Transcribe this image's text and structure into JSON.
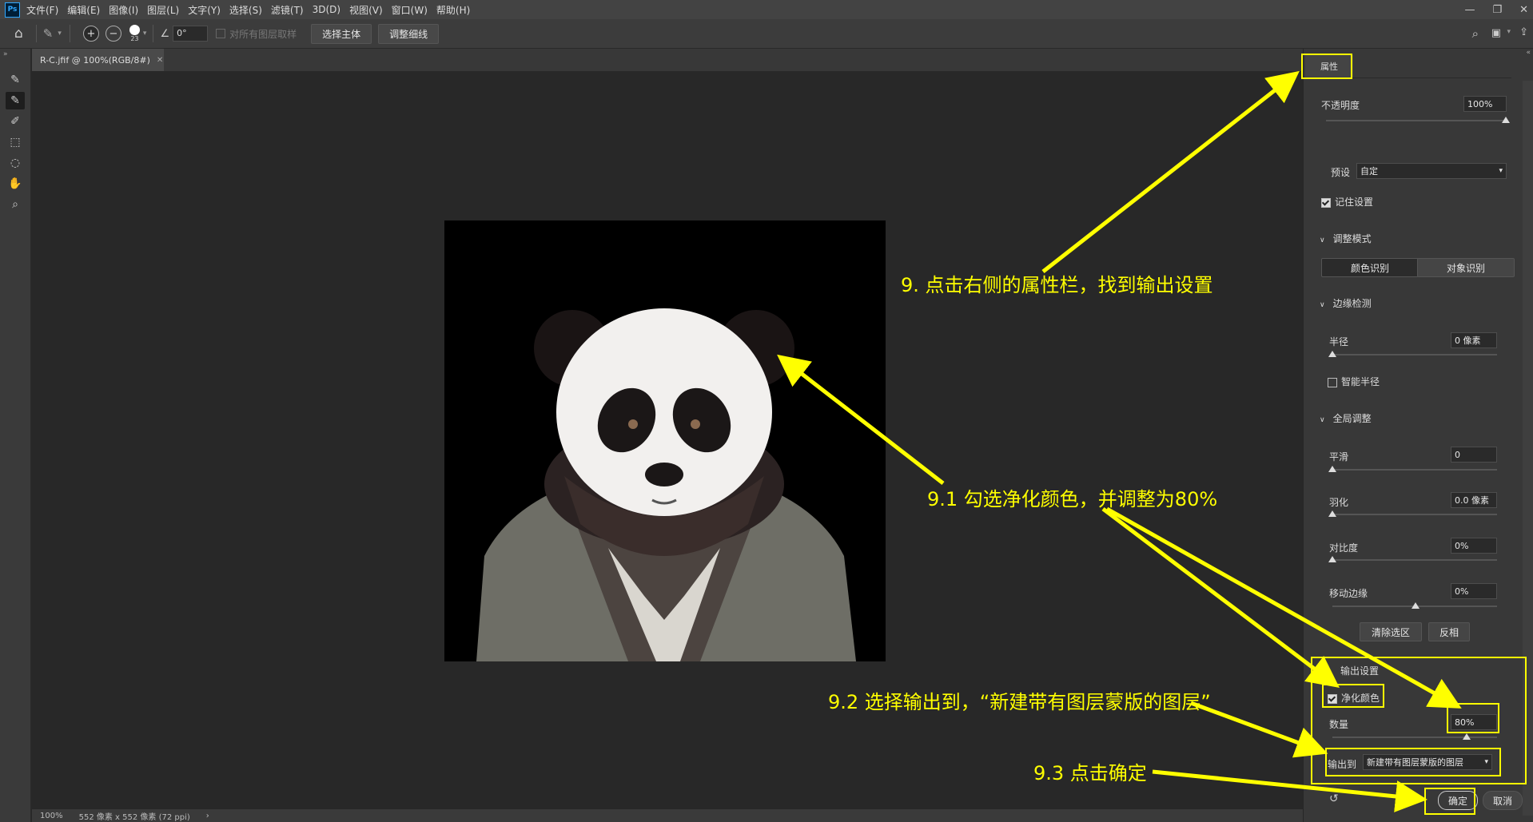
{
  "menu": {
    "app_icon": "Ps",
    "items": [
      "文件(F)",
      "编辑(E)",
      "图像(I)",
      "图层(L)",
      "文字(Y)",
      "选择(S)",
      "滤镜(T)",
      "3D(D)",
      "视图(V)",
      "窗口(W)",
      "帮助(H)"
    ]
  },
  "options": {
    "brush_size": "23",
    "angle": "0°",
    "sample_all_layers": "对所有图层取样",
    "select_subject": "选择主体",
    "refine_hair": "调整细线"
  },
  "document": {
    "tab_title": "R-C.jfif @ 100%(RGB/8#)",
    "zoom": "100%",
    "info": "552 像素 x 552 像素 (72 ppi)"
  },
  "panel": {
    "tab": "属性",
    "opacity_label": "不透明度",
    "opacity_value": "100%",
    "preset_label": "预设",
    "preset_value": "自定",
    "remember_label": "记住设置",
    "adjust_mode": "调整模式",
    "mode_color": "颜色识别",
    "mode_object": "对象识别",
    "edge_detection": "边缘检测",
    "radius_label": "半径",
    "radius_value": "0 像素",
    "smart_radius": "智能半径",
    "global_adjust": "全局调整",
    "smooth_label": "平滑",
    "smooth_value": "0",
    "feather_label": "羽化",
    "feather_value": "0.0 像素",
    "contrast_label": "对比度",
    "contrast_value": "0%",
    "shift_label": "移动边缘",
    "shift_value": "0%",
    "clear_selection": "清除选区",
    "invert": "反相",
    "output_settings": "输出设置",
    "decontaminate": "净化颜色",
    "amount_label": "数量",
    "amount_value": "80%",
    "output_to_label": "输出到",
    "output_to_value": "新建带有图层蒙版的图层",
    "ok": "确定",
    "cancel": "取消"
  },
  "annotations": {
    "a9": "9. 点击右侧的属性栏，找到输出设置",
    "a91": "9.1 勾选净化颜色，并调整为80%",
    "a92": "9.2 选择输出到，“新建带有图层蒙版的图层”",
    "a93": "9.3 点击确定"
  },
  "colors": {
    "annotation": "#ffff00",
    "panel_bg": "#383838",
    "canvas_bg": "#282828"
  }
}
